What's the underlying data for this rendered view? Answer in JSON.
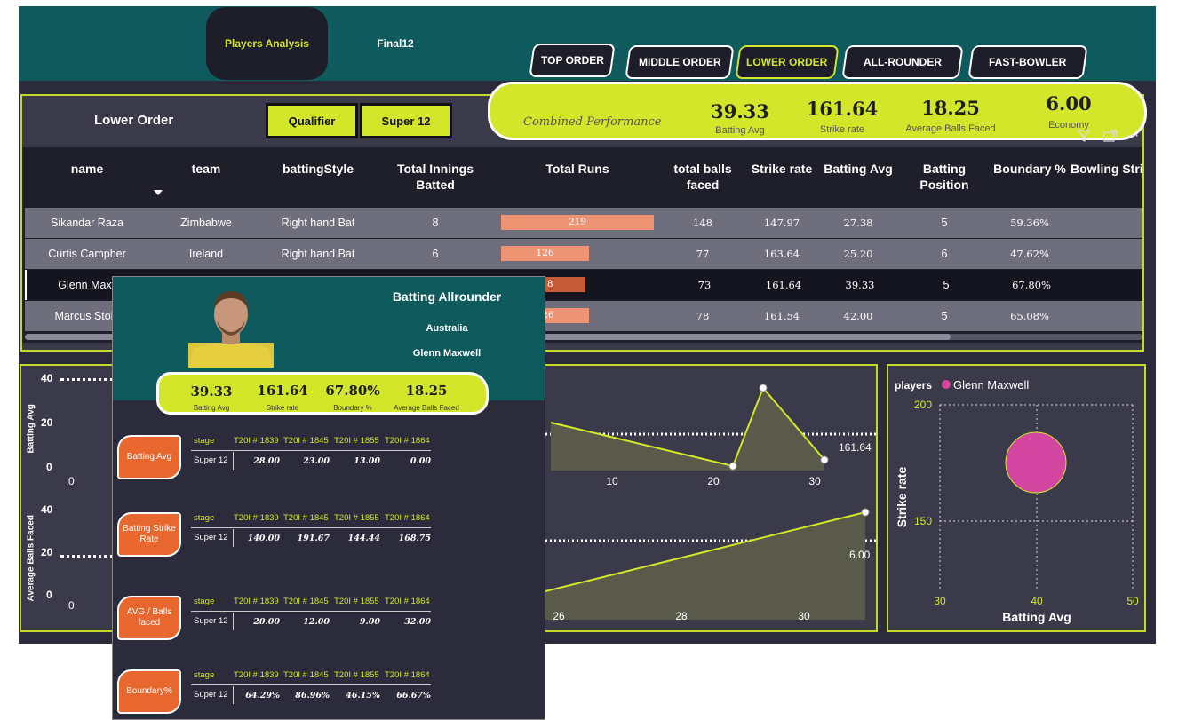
{
  "nav": {
    "tab_players": "Players Analysis",
    "tab_final": "Final12",
    "orders": [
      "TOP ORDER",
      "MIDDLE ORDER",
      "LOWER ORDER",
      "ALL-ROUNDER",
      "FAST-BOWLER"
    ],
    "active_order": "LOWER ORDER"
  },
  "section": {
    "title": "Lower Order",
    "stage_buttons": [
      "Qualifier",
      "Super 12"
    ]
  },
  "combined": {
    "label": "Combined Performance",
    "kpis": [
      {
        "value": "39.33",
        "label": "Batting Avg"
      },
      {
        "value": "161.64",
        "label": "Strike rate"
      },
      {
        "value": "18.25",
        "label": "Average Balls Faced"
      },
      {
        "value": "6.00",
        "label": "Economy"
      }
    ]
  },
  "table": {
    "headers": [
      "name",
      "team",
      "battingStyle",
      "Total Innings Batted",
      "Total Runs",
      "total balls faced",
      "Strike rate",
      "Batting Avg",
      "Batting Position",
      "Boundary %",
      "Bowling Stri"
    ],
    "rows": [
      {
        "name": "Sikandar Raza",
        "team": "Zimbabwe",
        "style": "Right hand Bat",
        "innings": "8",
        "runs": "219",
        "runs_value": 219,
        "balls": "148",
        "sr": "147.97",
        "avg": "27.38",
        "pos": "5",
        "boundary": "59.36%"
      },
      {
        "name": "Curtis Campher",
        "team": "Ireland",
        "style": "Right hand Bat",
        "innings": "6",
        "runs": "126",
        "runs_value": 126,
        "balls": "77",
        "sr": "163.64",
        "avg": "25.20",
        "pos": "6",
        "boundary": "47.62%"
      },
      {
        "name": "Glenn Maxw",
        "team": "",
        "style": "",
        "innings": "",
        "runs": "118",
        "runs_value": 118,
        "balls": "73",
        "sr": "161.64",
        "avg": "39.33",
        "pos": "5",
        "boundary": "67.80%"
      },
      {
        "name": "Marcus Stoin",
        "team": "",
        "style": "",
        "innings": "",
        "runs": "126",
        "runs_value": 126,
        "balls": "78",
        "sr": "161.54",
        "avg": "42.00",
        "pos": "5",
        "boundary": "65.08%"
      }
    ]
  },
  "tooltip": {
    "role": "Batting Allrounder",
    "country": "Australia",
    "player": "Glenn Maxwell",
    "kpis": [
      {
        "value": "39.33",
        "label": "Batting Avg"
      },
      {
        "value": "161.64",
        "label": "Strike rate"
      },
      {
        "value": "67.80%",
        "label": "Boundary %"
      },
      {
        "value": "18.25",
        "label": "Average Balls Faced"
      }
    ],
    "matches": [
      "T20I # 1839",
      "T20I # 1845",
      "T20I # 1855",
      "T20I # 1864"
    ],
    "stage_label": "stage",
    "stage": "Super 12",
    "metrics": [
      {
        "name": "Batting Avg",
        "values": [
          "28.00",
          "23.00",
          "13.00",
          "0.00"
        ]
      },
      {
        "name": "Batting Strike Rate",
        "values": [
          "140.00",
          "191.67",
          "144.44",
          "168.75"
        ]
      },
      {
        "name": "AVG / Balls faced",
        "values": [
          "20.00",
          "12.00",
          "9.00",
          "32.00"
        ]
      },
      {
        "name": "Boundary%",
        "values": [
          "64.29%",
          "86.96%",
          "46.15%",
          "66.67%"
        ]
      }
    ]
  },
  "left_chart": {
    "ylabel_top": "Batting Avg",
    "ylabel_bottom": "Average Balls Faced",
    "ticks_top": [
      "40",
      "20",
      "0"
    ],
    "ticks_bottom": [
      "40",
      "20",
      "0"
    ],
    "zero_top": "0",
    "zero_bottom": "0"
  },
  "chart_data": [
    {
      "type": "line",
      "x": [
        12,
        22,
        25,
        30
      ],
      "y": [
        165,
        144,
        208,
        148
      ],
      "xticks": [
        "10",
        "20",
        "30"
      ],
      "ref_label": "161.64"
    },
    {
      "type": "line",
      "x": [
        24,
        31
      ],
      "y": [
        4.5,
        7.2
      ],
      "xticks": [
        "26",
        "28",
        "30"
      ],
      "ref_label": "6.00"
    },
    {
      "type": "scatter",
      "legend_title": "players",
      "series": [
        {
          "name": "Glenn Maxwell",
          "x": [
            40
          ],
          "y": [
            161.64
          ],
          "color": "#d347a0"
        }
      ],
      "xlabel": "Batting Avg",
      "ylabel": "Strike rate",
      "xticks": [
        "30",
        "40",
        "50"
      ],
      "yticks": [
        "200",
        "150"
      ],
      "xlim": [
        30,
        50
      ],
      "ylim": [
        125,
        200
      ]
    }
  ]
}
